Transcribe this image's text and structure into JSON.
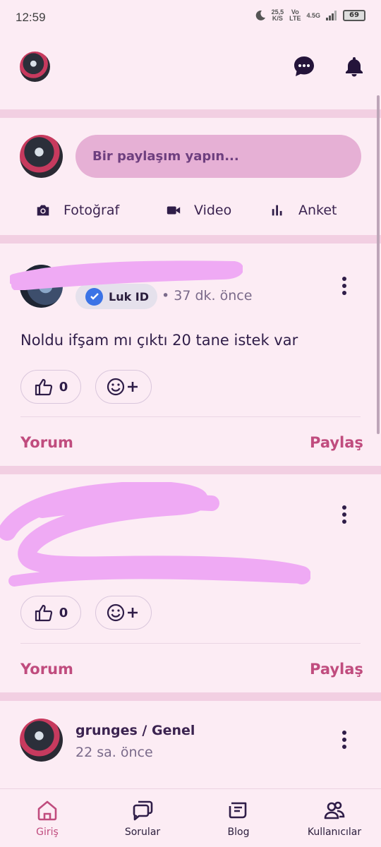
{
  "status": {
    "time": "12:59",
    "net_speed": "25,5",
    "net_unit": "K/S",
    "carrier_top": "Vo",
    "carrier_bottom": "LTE",
    "signal": "4.5G",
    "battery": "69"
  },
  "composer": {
    "placeholder": "Bir paylaşım yapın...",
    "actions": {
      "photo": "Fotoğraf",
      "video": "Video",
      "poll": "Anket"
    }
  },
  "posts": [
    {
      "badge": "Luk ID",
      "time": "• 37 dk. önce",
      "text": "Noldu ifşam mı çıktı 20 tane istek var",
      "likes": "0",
      "comment_label": "Yorum",
      "share_label": "Paylaş"
    },
    {
      "likes": "0",
      "comment_label": "Yorum",
      "share_label": "Paylaş"
    },
    {
      "author": "grunges / Genel",
      "time": "22 sa. önce"
    }
  ],
  "nav": {
    "home": "Giriş",
    "questions": "Sorular",
    "blog": "Blog",
    "users": "Kullanıcılar"
  },
  "colors": {
    "accent": "#c04c7e",
    "background": "#fcecf4",
    "input": "#e6b0d5",
    "redaction": "#efaaf4"
  }
}
